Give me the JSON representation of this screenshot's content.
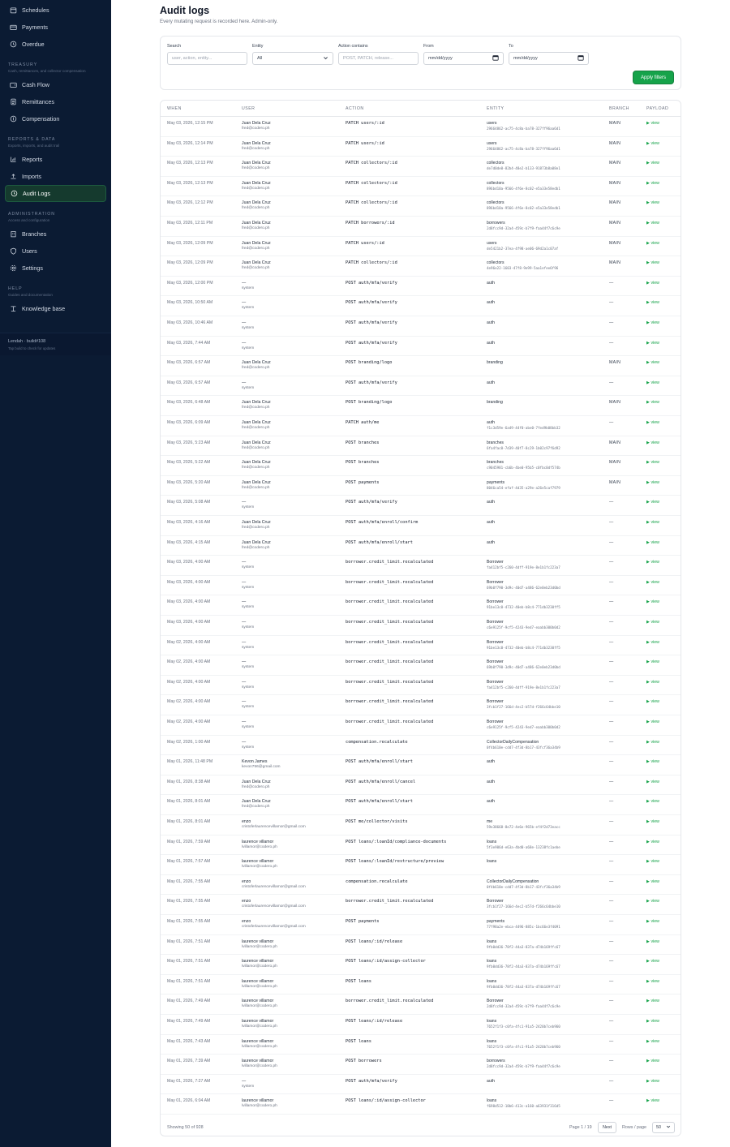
{
  "sidebar": {
    "top_items": [
      {
        "label": "Schedules",
        "icon": "calendar-icon"
      },
      {
        "label": "Payments",
        "icon": "card-icon"
      },
      {
        "label": "Overdue",
        "icon": "clock-icon"
      }
    ],
    "sections": [
      {
        "title": "TREASURY",
        "subtitle": "Cash, remittances, and collector compensation",
        "items": [
          {
            "label": "Cash Flow",
            "icon": "wallet-icon"
          },
          {
            "label": "Remittances",
            "icon": "document-icon"
          },
          {
            "label": "Compensation",
            "icon": "coin-icon"
          }
        ]
      },
      {
        "title": "REPORTS & DATA",
        "subtitle": "Exports, imports, and audit trail",
        "items": [
          {
            "label": "Reports",
            "icon": "chart-icon"
          },
          {
            "label": "Imports",
            "icon": "upload-icon"
          },
          {
            "label": "Audit Logs",
            "icon": "history-icon",
            "active": true
          }
        ]
      },
      {
        "title": "ADMINISTRATION",
        "subtitle": "Access and configuration",
        "items": [
          {
            "label": "Branches",
            "icon": "building-icon"
          },
          {
            "label": "Users",
            "icon": "shield-icon"
          },
          {
            "label": "Settings",
            "icon": "gear-icon"
          }
        ]
      },
      {
        "title": "HELP",
        "subtitle": "Guides and documentation",
        "items": [
          {
            "label": "Knowledge base",
            "icon": "book-icon"
          }
        ]
      }
    ],
    "footer": {
      "line1": "Lendah · build#108",
      "line2": "Tap build to check for updates"
    }
  },
  "page": {
    "title": "Audit logs",
    "subtitle": "Every mutating request is recorded here. Admin-only."
  },
  "filters": {
    "search_label": "Search",
    "search_placeholder": "user, action, entity...",
    "entity_label": "Entity",
    "entity_value": "All",
    "action_label": "Action contains",
    "action_placeholder": "POST, PATCH, release...",
    "from_label": "From",
    "from_value": "mm/dd/yyyy",
    "to_label": "To",
    "to_value": "mm/dd/yyyy",
    "apply_label": "Apply filters"
  },
  "table": {
    "columns": [
      "WHEN",
      "USER",
      "ACTION",
      "ENTITY",
      "BRANCH",
      "PAYLOAD"
    ],
    "view_label": "view",
    "rows": [
      [
        "May 03, 2026, 12:15 PM",
        "Juan Dela Cruz",
        "fred@codero.ph",
        "PATCH users/:id",
        "users",
        "29664862-ac75-4c8a-ba78-327ff96aa6d1",
        "MAIN"
      ],
      [
        "May 03, 2026, 12:14 PM",
        "Juan Dela Cruz",
        "fred@codero.ph",
        "PATCH users/:id",
        "users",
        "29664862-ac75-4c8a-ba78-327ff96aa6d1",
        "MAIN"
      ],
      [
        "May 03, 2026, 12:13 PM",
        "Juan Dela Cruz",
        "fred@codero.ph",
        "PATCH collectors/:id",
        "collectors",
        "de7d0de0-82b4-48e2-b133-91873b8a08e1",
        "MAIN"
      ],
      [
        "May 03, 2026, 12:13 PM",
        "Juan Dela Cruz",
        "fred@codero.ph",
        "PATCH collectors/:id",
        "collectors",
        "896bd10a-9566-4f6e-8c02-e5a33e58edb1",
        "MAIN"
      ],
      [
        "May 03, 2026, 12:12 PM",
        "Juan Dela Cruz",
        "fred@codero.ph",
        "PATCH collectors/:id",
        "collectors",
        "896bd10a-9566-4f6e-8c02-e5a33e58edb1",
        "MAIN"
      ],
      [
        "May 03, 2026, 12:11 PM",
        "Juan Dela Cruz",
        "fred@codero.ph",
        "PATCH borrowers/:id",
        "borrowers",
        "2d8fcc9d-32a4-459c-b7f9-faa44f7c6c9e",
        "MAIN"
      ],
      [
        "May 03, 2026, 12:09 PM",
        "Juan Dela Cruz",
        "fred@codero.ph",
        "PATCH users/:id",
        "users",
        "de5421b2-37ea-4f98-ae06-69d2a1c07af",
        "MAIN"
      ],
      [
        "May 03, 2026, 12:09 PM",
        "Juan Dela Cruz",
        "fred@codero.ph",
        "PATCH collectors/:id",
        "collectors",
        "4e96e22-1603-47f8-9e99-5aa1efee6f96",
        "MAIN"
      ],
      [
        "May 03, 2026, 12:00 PM",
        "—",
        "system",
        "POST auth/mfa/verify",
        "auth",
        "",
        "—"
      ],
      [
        "May 03, 2026, 10:50 AM",
        "—",
        "system",
        "POST auth/mfa/verify",
        "auth",
        "",
        "—"
      ],
      [
        "May 03, 2026, 10:46 AM",
        "—",
        "system",
        "POST auth/mfa/verify",
        "auth",
        "",
        "—"
      ],
      [
        "May 03, 2026, 7:44 AM",
        "—",
        "system",
        "POST auth/mfa/verify",
        "auth",
        "",
        "—"
      ],
      [
        "May 03, 2026, 6:57 AM",
        "Juan Dela Cruz",
        "fred@codero.ph",
        "POST branding/logo",
        "branding",
        "",
        "MAIN"
      ],
      [
        "May 03, 2026, 6:57 AM",
        "—",
        "system",
        "POST auth/mfa/verify",
        "auth",
        "",
        "—"
      ],
      [
        "May 03, 2026, 6:48 AM",
        "Juan Dela Cruz",
        "fred@codero.ph",
        "POST branding/logo",
        "branding",
        "",
        "MAIN"
      ],
      [
        "May 03, 2026, 6:09 AM",
        "Juan Dela Cruz",
        "fred@codero.ph",
        "PATCH auth/me",
        "auth",
        "f1c3d59e-6a49-44f0-abe0-7fed9b08bb32",
        "—"
      ],
      [
        "May 03, 2026, 5:23 AM",
        "Juan Dela Cruz",
        "fred@codero.ph",
        "POST branches",
        "branches",
        "6fa4fac0-7d39-40f7-8c29-1b02c97f6d92",
        "MAIN"
      ],
      [
        "May 03, 2026, 5:22 AM",
        "Juan Dela Cruz",
        "fred@codero.ph",
        "POST branches",
        "branches",
        "c9045981-cb6b-4be0-95b5-c0fbc0df574b",
        "MAIN"
      ],
      [
        "May 03, 2026, 5:20 AM",
        "Juan Dela Cruz",
        "fred@codero.ph",
        "POST payments",
        "payments",
        "8046ca54-efaf-4d35-a29e-a26e5caf7979",
        "MAIN"
      ],
      [
        "May 03, 2026, 5:08 AM",
        "—",
        "system",
        "POST auth/mfa/verify",
        "auth",
        "",
        "—"
      ],
      [
        "May 03, 2026, 4:16 AM",
        "Juan Dela Cruz",
        "fred@codero.ph",
        "POST auth/mfa/enroll/confirm",
        "auth",
        "",
        "—"
      ],
      [
        "May 03, 2026, 4:15 AM",
        "Juan Dela Cruz",
        "fred@codero.ph",
        "POST auth/mfa/enroll/start",
        "auth",
        "",
        "—"
      ],
      [
        "May 03, 2026, 4:00 AM",
        "—",
        "system",
        "borrower.credit_limit.recalculated",
        "Borrower",
        "fa412bf5-c260-4dff-919e-8e1b1fc223a7",
        "—"
      ],
      [
        "May 03, 2026, 4:00 AM",
        "—",
        "system",
        "borrower.credit_limit.recalculated",
        "Borrower",
        "69b0f790-3d9c-40d7-a486-62e0eb23d0bd",
        "—"
      ],
      [
        "May 03, 2026, 4:00 AM",
        "—",
        "system",
        "borrower.credit_limit.recalculated",
        "Borrower",
        "91be13c0-4732-40eb-b8c4-771db3230ff5",
        "—"
      ],
      [
        "May 03, 2026, 4:00 AM",
        "—",
        "system",
        "borrower.credit_limit.recalculated",
        "Borrower",
        "c6e9125f-9cf5-4243-9ed7-eaabb300b0d2",
        "—"
      ],
      [
        "May 02, 2026, 4:00 AM",
        "—",
        "system",
        "borrower.credit_limit.recalculated",
        "Borrower",
        "91be13c0-4732-40eb-b8c4-771db3230ff5",
        "—"
      ],
      [
        "May 02, 2026, 4:00 AM",
        "—",
        "system",
        "borrower.credit_limit.recalculated",
        "Borrower",
        "69b0f790-3d9c-40d7-a486-62e0eb23d0bd",
        "—"
      ],
      [
        "May 02, 2026, 4:00 AM",
        "—",
        "system",
        "borrower.credit_limit.recalculated",
        "Borrower",
        "fa412bf5-c260-4dff-919e-8e1b1fc223a7",
        "—"
      ],
      [
        "May 02, 2026, 4:00 AM",
        "—",
        "system",
        "borrower.credit_limit.recalculated",
        "Borrower",
        "3fcb1f27-166d-4ec2-b57d-f266c64bbe10",
        "—"
      ],
      [
        "May 02, 2026, 4:00 AM",
        "—",
        "system",
        "borrower.credit_limit.recalculated",
        "Borrower",
        "c6e9125f-9cf5-4243-9ed7-eaabb300b0d2",
        "—"
      ],
      [
        "May 02, 2026, 1:00 AM",
        "—",
        "system",
        "compensation.recalculate",
        "CollectorDailyCompensation",
        "0f4b610e-cdd7-4f3d-8b17-43fcf36a34b9",
        "—"
      ],
      [
        "May 01, 2026, 11:48 PM",
        "Kevon James",
        "kevon756@gmail.com",
        "POST auth/mfa/enroll/start",
        "auth",
        "",
        "—"
      ],
      [
        "May 01, 2026, 8:38 AM",
        "Juan Dela Cruz",
        "fred@codero.ph",
        "POST auth/mfa/enroll/cancel",
        "auth",
        "",
        "—"
      ],
      [
        "May 01, 2026, 8:01 AM",
        "Juan Dela Cruz",
        "fred@codero.ph",
        "POST auth/mfa/enroll/start",
        "auth",
        "",
        "—"
      ],
      [
        "May 01, 2026, 8:01 AM",
        "enzo",
        "cristoferlaurencevillamor@gmail.com",
        "POST me/collector/visits",
        "me",
        "59e38668-8e72-4e6e-965b-ef4f2d73eacc",
        "—"
      ],
      [
        "May 01, 2026, 7:59 AM",
        "laurence villamor",
        "lvillamor@codero.ph",
        "POST loans/:loanId/compliance-documents",
        "loans",
        "5f3e906d-e63a-4bd0-a68e-13238fc1aebe",
        "—"
      ],
      [
        "May 01, 2026, 7:57 AM",
        "laurence villamor",
        "lvillamor@codero.ph",
        "POST loans/:loanId/restructure/preview",
        "loans",
        "",
        "—"
      ],
      [
        "May 01, 2026, 7:55 AM",
        "enzo",
        "cristoferlaurencevillamor@gmail.com",
        "compensation.recalculate",
        "CollectorDailyCompensation",
        "0f4b610e-cdd7-4f3d-8b17-43fcf36a34b9",
        "—"
      ],
      [
        "May 01, 2026, 7:55 AM",
        "enzo",
        "cristoferlaurencevillamor@gmail.com",
        "borrower.credit_limit.recalculated",
        "Borrower",
        "3fcb1f27-166d-4ec2-b57d-f266c64bbe10",
        "—"
      ],
      [
        "May 01, 2026, 7:55 AM",
        "enzo",
        "cristoferlaurencevillamor@gmail.com",
        "POST payments",
        "payments",
        "77f98a2e-ebca-4496-885c-1bc66e3f4091",
        "—"
      ],
      [
        "May 01, 2026, 7:51 AM",
        "laurence villamor",
        "lvillamor@codero.ph",
        "POST loans/:id/release",
        "loans",
        "9fb0dd36-78f2-44a3-837a-d74b169ffc67",
        "—"
      ],
      [
        "May 01, 2026, 7:51 AM",
        "laurence villamor",
        "lvillamor@codero.ph",
        "POST loans/:id/assign-collector",
        "loans",
        "9fb0dd36-78f2-44a3-837a-d74b169ffc67",
        "—"
      ],
      [
        "May 01, 2026, 7:51 AM",
        "laurence villamor",
        "lvillamor@codero.ph",
        "POST loans",
        "loans",
        "9fb0dd36-78f2-44a3-837a-d74b169ffc67",
        "—"
      ],
      [
        "May 01, 2026, 7:49 AM",
        "laurence villamor",
        "lvillamor@codero.ph",
        "borrower.credit_limit.recalculated",
        "Borrower",
        "2d8fcc9d-32a4-459c-b7f9-faa44f7c6c9e",
        "—"
      ],
      [
        "May 01, 2026, 7:49 AM",
        "laurence villamor",
        "lvillamor@codero.ph",
        "POST loans/:id/release",
        "loans",
        "7652f1f3-c0fa-4fc1-91a5-2420b7ceb960",
        "—"
      ],
      [
        "May 01, 2026, 7:43 AM",
        "laurence villamor",
        "lvillamor@codero.ph",
        "POST loans",
        "loans",
        "7652f1f3-c0fa-4fc1-91a5-2420b7ceb960",
        "—"
      ],
      [
        "May 01, 2026, 7:39 AM",
        "laurence villamor",
        "lvillamor@codero.ph",
        "POST borrowers",
        "borrowers",
        "2d8fcc9d-32a4-459c-b7f9-faa44f7c6c9e",
        "—"
      ],
      [
        "May 01, 2026, 7:27 AM",
        "—",
        "system",
        "POST auth/mfa/verify",
        "auth",
        "",
        "—"
      ],
      [
        "May 01, 2026, 6:04 AM",
        "laurence villamor",
        "lvillamor@codero.ph",
        "POST loans/:id/assign-collector",
        "loans",
        "f698d512-18b6-413c-a160-a63931f316d5",
        "—"
      ]
    ]
  },
  "footer": {
    "count": "Showing 50 of 928",
    "page": "Page 1 / 19",
    "next_label": "Next",
    "rows_label": "Rows / page",
    "rows_value": "50"
  },
  "colors": {
    "sidebar_bg": "#0b1b33",
    "accent": "#16a34a"
  }
}
